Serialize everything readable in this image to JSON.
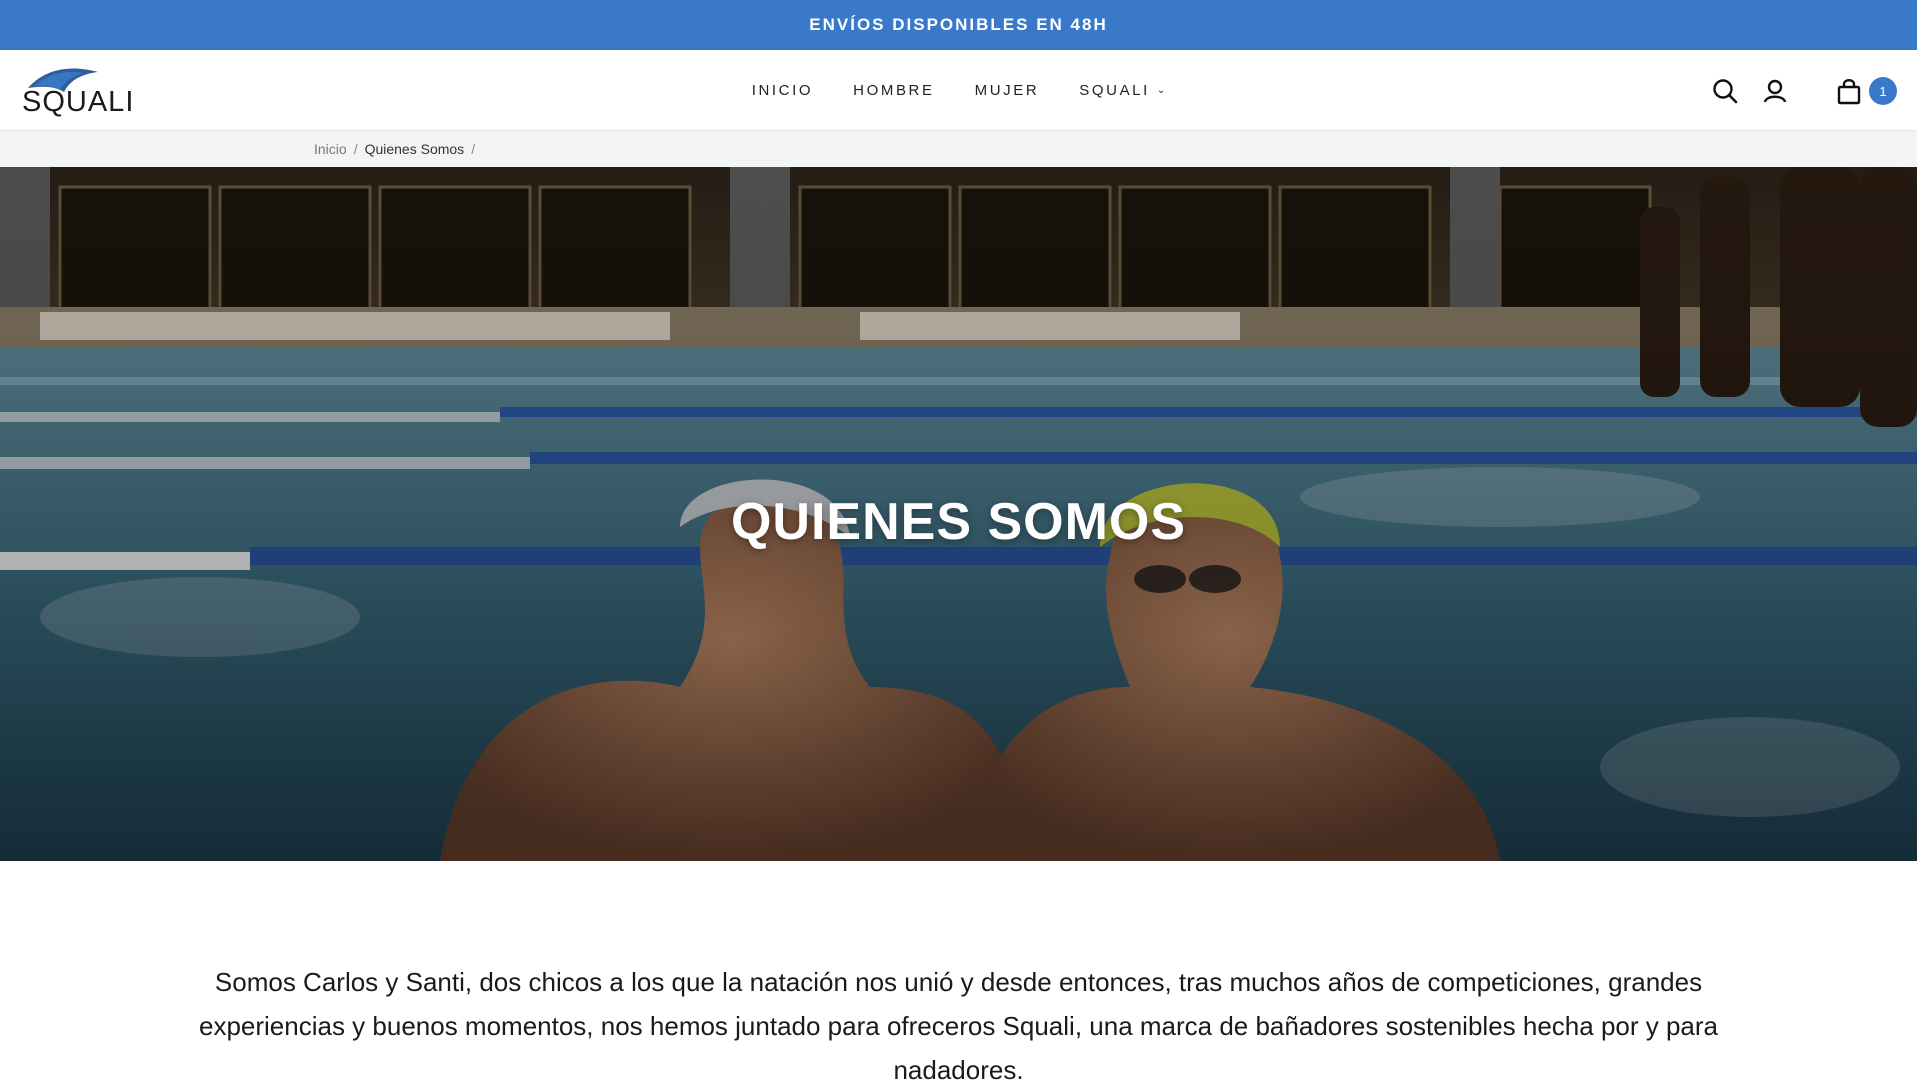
{
  "announcement": "ENVÍOS DISPONIBLES EN 48H",
  "brand": {
    "name": "SQUALI",
    "accent": "#3a79c9"
  },
  "nav": {
    "items": [
      {
        "label": "INICIO"
      },
      {
        "label": "HOMBRE"
      },
      {
        "label": "MUJER"
      },
      {
        "label": "SQUALI"
      }
    ]
  },
  "header_icons": [
    "search-icon",
    "account-icon",
    "cart-icon"
  ],
  "cart": {
    "count": "1"
  },
  "breadcrumb": {
    "home": "Inicio",
    "current": "Quienes Somos",
    "separator": "/"
  },
  "hero": {
    "title": "QUIENES SOMOS"
  },
  "intro": {
    "text": "Somos Carlos y Santi, dos chicos a los que la natación nos unió y desde entonces, tras muchos años de competiciones, grandes experiencias y buenos momentos, nos hemos juntado para ofreceros Squali, una marca de bañadores sostenibles hecha por y para nadadores."
  }
}
